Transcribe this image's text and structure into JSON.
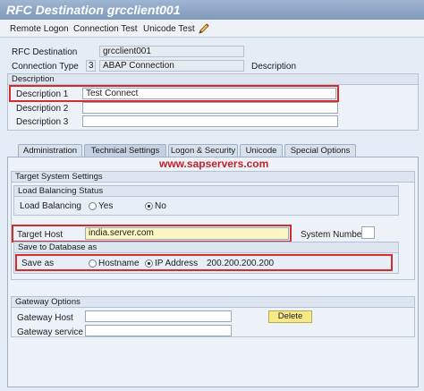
{
  "window": {
    "title": "RFC Destination grcclient001"
  },
  "toolbar": {
    "remote_logon": "Remote Logon",
    "connection_test": "Connection Test",
    "unicode_test": "Unicode Test"
  },
  "header": {
    "rfc_destination_label": "RFC Destination",
    "rfc_destination_value": "grcclient001",
    "connection_type_label": "Connection Type",
    "connection_type_code": "3",
    "connection_type_value": "ABAP Connection",
    "description_label": "Description"
  },
  "description_group": {
    "header": "Description",
    "desc1_label": "Description 1",
    "desc1_value": "Test Connect",
    "desc2_label": "Description 2",
    "desc2_value": "",
    "desc3_label": "Description 3",
    "desc3_value": ""
  },
  "tabs": [
    {
      "label": "Administration"
    },
    {
      "label": "Technical Settings"
    },
    {
      "label": "Logon & Security"
    },
    {
      "label": "Unicode"
    },
    {
      "label": "Special Options"
    }
  ],
  "watermark": "www.sapservers.com",
  "target_system": {
    "header": "Target System Settings",
    "load_balancing": {
      "header": "Load Balancing Status",
      "label": "Load Balancing",
      "yes": "Yes",
      "no": "No",
      "selected": "No"
    },
    "target_host_label": "Target Host",
    "target_host_value": "india.server.com",
    "system_number_label": "System Number",
    "system_number_value": "",
    "save_db": {
      "header": "Save to Database as",
      "label": "Save as",
      "hostname": "Hostname",
      "ip_address": "IP Address",
      "selected": "IP Address",
      "ip_value": "200.200.200.200"
    }
  },
  "gateway": {
    "header": "Gateway Options",
    "host_label": "Gateway Host",
    "host_value": "",
    "service_label": "Gateway service",
    "service_value": "",
    "delete_label": "Delete"
  },
  "colors": {
    "highlight_red": "#d22d2d",
    "watermark_red": "#c5202a",
    "delete_button": "#f5e98a"
  }
}
